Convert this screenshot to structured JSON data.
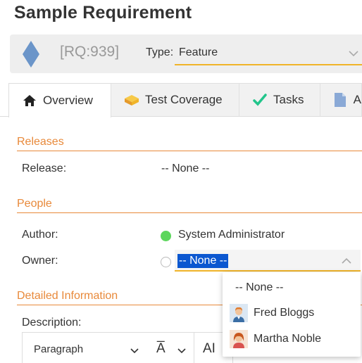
{
  "page": {
    "title": "Sample Requirement"
  },
  "header": {
    "token": "[RQ:939]",
    "type_label": "Type:",
    "type_value": "Feature",
    "diamond_color": "#6b95c9",
    "underline_color": "#f0b429"
  },
  "tabs": [
    {
      "label": "Overview",
      "icon": "home-icon",
      "active": true
    },
    {
      "label": "Test Coverage",
      "icon": "test-coverage-icon",
      "active": false
    },
    {
      "label": "Tasks",
      "icon": "checkmark-icon",
      "active": false
    },
    {
      "label": "A",
      "icon": "document-icon",
      "active": false
    }
  ],
  "sections": {
    "releases": {
      "title": "Releases",
      "release_label": "Release:",
      "release_value": "-- None --"
    },
    "people": {
      "title": "People",
      "author_label": "Author:",
      "author_value": "System Administrator",
      "author_status_color": "#5cd65c",
      "owner_label": "Owner:",
      "owner_value": "-- None --"
    },
    "detailed": {
      "title": "Detailed Information",
      "description_label": "Description:"
    }
  },
  "owner_dropdown": {
    "options": [
      {
        "label": "-- None --",
        "avatar": ""
      },
      {
        "label": "Fred Bloggs",
        "avatar": "male-avatar-icon"
      },
      {
        "label": "Martha Noble",
        "avatar": "female-avatar-icon"
      }
    ]
  },
  "editor": {
    "paragraph_label": "Paragraph",
    "font_icon": "A̅",
    "size_icon": "AI"
  },
  "colors": {
    "accent": "#e8893a",
    "selection": "#0b57d0"
  }
}
